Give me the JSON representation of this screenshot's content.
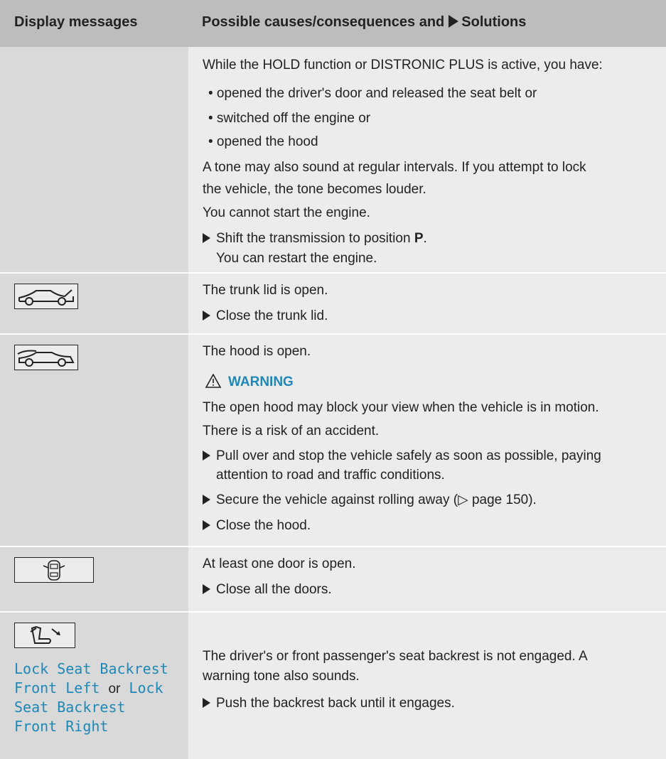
{
  "header": {
    "col1": "Display messages",
    "col2_a": "Possible causes/consequences and",
    "col2_b": "Solutions"
  },
  "rows": {
    "hold": {
      "intro": "While the HOLD function or DISTRONIC PLUS is active, you have:",
      "bullets": [
        "• opened the driver's door and released the seat belt or",
        "• switched off the engine or",
        "• opened the hood"
      ],
      "tone1": "A tone may also sound at regular intervals. If you attempt to lock",
      "tone2": "the vehicle, the tone becomes louder.",
      "nostart": "You cannot start the engine.",
      "action_pre": "Shift the transmission to position ",
      "action_bold": "P",
      "action_post": ".",
      "action2": "You can restart the engine."
    },
    "trunk": {
      "icon": "trunk-open-icon",
      "text": "The trunk lid is open.",
      "action": "Close the trunk lid."
    },
    "hood": {
      "icon": "hood-open-icon",
      "text": "The hood is open.",
      "warning": "WARNING",
      "w1": "The open hood may block your view when the vehicle is in motion.",
      "w2": "There is a risk of an accident.",
      "a1": "Pull over and stop the vehicle safely as soon as possible, paying",
      "a1b": "attention to road and traffic conditions.",
      "a2": "Secure the vehicle against rolling away (▷ page 150).",
      "a3": "Close the hood."
    },
    "door": {
      "icon": "door-open-icon",
      "text": "At least one door is open.",
      "action": "Close all the doors."
    },
    "seat": {
      "icon": "seat-backrest-icon",
      "msg1": "Lock Seat Backrest",
      "msg2a": "Front Left",
      "msg2b": "or",
      "msg2c": "Lock",
      "msg3": "Seat Backrest",
      "msg4": "Front Right",
      "text1": "The driver's or front passenger's seat backrest is not engaged. A",
      "text2": "warning tone also sounds.",
      "action": "Push the backrest back until it engages."
    }
  },
  "colors": {
    "accent": "#1e88b8",
    "header_bg": "#bdbdbd",
    "left_bg": "#d9d9d9",
    "right_bg": "#ececec"
  }
}
